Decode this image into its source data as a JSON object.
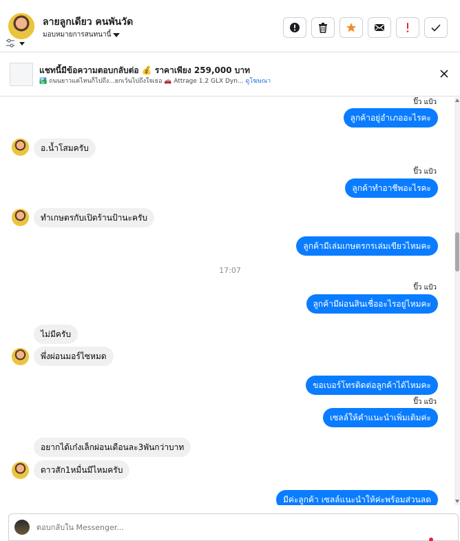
{
  "header": {
    "name": "ลายลูกเดียว คนพันวัด",
    "assign_label": "มอบหมายการสนทนานี้",
    "actions": [
      "alert-circle-icon",
      "trash-icon",
      "star-icon",
      "envelope-icon",
      "exclamation-icon",
      "check-icon"
    ]
  },
  "ad": {
    "title": "แชทนี้มีข้อความตอบกลับต่อ 💰 ราคาเพียง 259,000 บาท",
    "line1": "🏞️ ถนนยาวแค่ไหนก็ไปถึง...ยกเว้นไปถึงใจเธอ 🚗 Attrage 1.2 GLX Dyn...",
    "link": "ดูโฆษณา"
  },
  "messages": {
    "seen": "ปิ๊ว แป้ว",
    "m1": "ลูกค้าอยู่อำเภออะไรคะ",
    "m2": "อ.น้ำโสมครับ",
    "m3": "ลูกค้าทำอาชีพอะไรคะ",
    "m4": "ทำเกษตรกับเปิดร้านป้านะครับ",
    "m5": "ลูกค้ามีเล่มเกษตรกรเล่มเขียวไหมคะ",
    "time": "17:07",
    "m6": "ลูกค้ามีผ่อนสินเชื่ออะไรอยู่ไหมคะ",
    "m7": "ไม่มีครับ",
    "m8": "พึ่งผ่อนมอร์ไซหมด",
    "m9": "ขอเบอร์โทรติดต่อลูกค้าได้ไหมคะ",
    "m10": "เซลล์ให้คำแนะนำเพิ่มเติมค่ะ",
    "m11": "อยากได้เก๋งเล็กผ่อนเดือนละ3พันกว่าบาท",
    "m12": "ดาวสัก1หมื่นมีไหมครับ",
    "m13": "มีค่ะลูกค้า  เซลล์แนะนำให้ค่ะพร้อมส่วนลด"
  },
  "composer": {
    "placeholder": "ตอบกลับใน Messenger..."
  }
}
